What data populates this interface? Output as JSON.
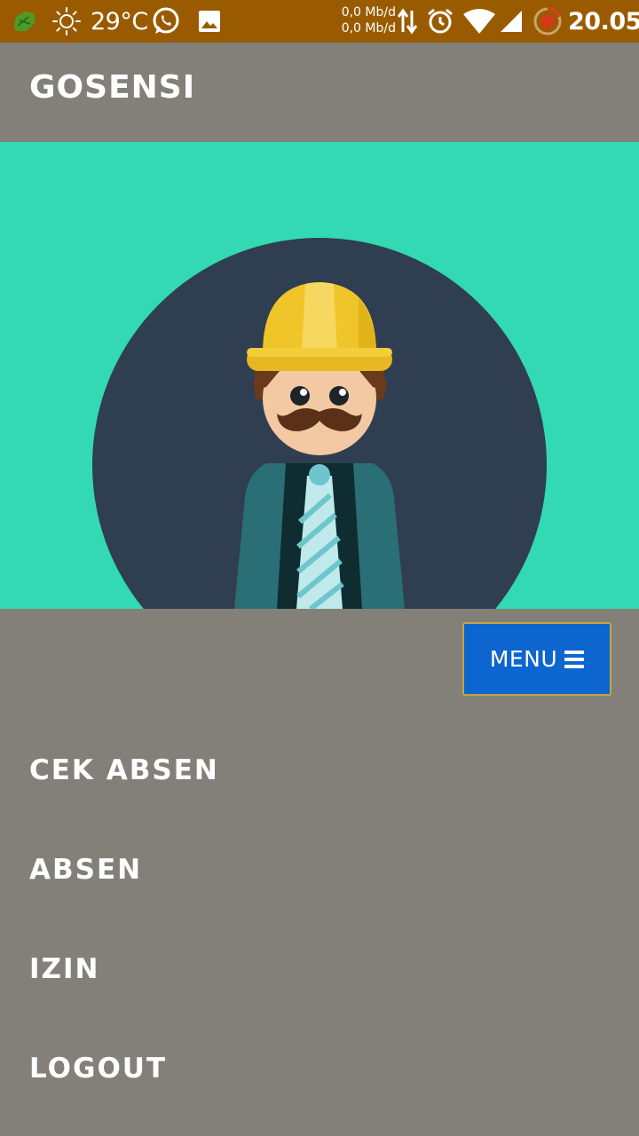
{
  "status_bar": {
    "temperature": "29°C",
    "net_up": "0,0 Mb/d",
    "net_down": "0,0 Mb/d",
    "time": "20.05",
    "icons": [
      "app-icon",
      "sun-icon",
      "whatsapp-icon",
      "gallery-icon",
      "data-arrows-icon",
      "alarm-icon",
      "wifi-icon",
      "signal-icon",
      "battery-icon"
    ]
  },
  "app_bar": {
    "title": "GOSENSI"
  },
  "hero": {
    "illustration": "worker-avatar",
    "background_color": "#33d9b2",
    "circle_color": "#2f3e50"
  },
  "menu_button": {
    "label": "MENU",
    "icon": "hamburger-icon",
    "color": "#0d66d0"
  },
  "nav": {
    "items": [
      {
        "label": "CEK ABSEN"
      },
      {
        "label": "ABSEN"
      },
      {
        "label": "IZIN"
      },
      {
        "label": "LOGOUT"
      }
    ]
  }
}
